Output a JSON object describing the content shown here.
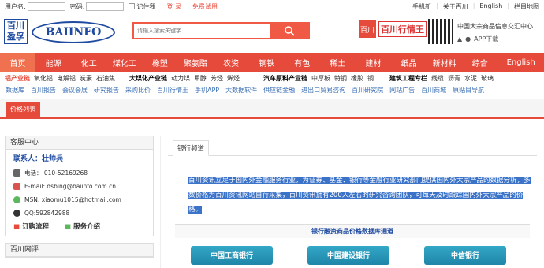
{
  "topbar": {
    "username_label": "用户名:",
    "password_label": "密码:",
    "remember_label": "记住我",
    "login_label": "登 录",
    "trial_label": "免费试用",
    "right_links": [
      "手机新",
      "关于百川",
      "English",
      "栏目地图"
    ]
  },
  "header": {
    "logo_cn": "百川\n盈孚",
    "logo_en": "BAIINFO",
    "search_placeholder": "请输入搜索关键字",
    "brand_name": "百川行情王",
    "brand_square": "百川",
    "qr_title": "中国大宗商品信息交汇中心",
    "app_label": "APP下载"
  },
  "nav": [
    "首页",
    "能源",
    "化工",
    "煤化工",
    "橡塑",
    "聚氨酯",
    "农资",
    "钢铁",
    "有色",
    "稀土",
    "建材",
    "纸品",
    "新材料",
    "综合",
    "English"
  ],
  "categories": {
    "row1": [
      {
        "title": "铝产业链",
        "items": [
          "氧化铝",
          "电解铝",
          "炭素",
          "石油焦"
        ]
      },
      {
        "title": "大煤化产业链",
        "items": [
          "动力煤",
          "甲醇",
          "芳烃",
          "烯烃"
        ]
      },
      {
        "title": "汽车原料产业链",
        "items": [
          "中厚板",
          "特钢",
          "橡胶",
          "铜"
        ]
      },
      {
        "title": "建筑工程专栏",
        "items": [
          "线缆",
          "沥青",
          "水泥",
          "玻璃"
        ]
      }
    ],
    "links": [
      "数据库",
      "百川报告",
      "会议会展",
      "研究报告",
      "采购比价",
      "百川行情王",
      "手机APP",
      "大数据软件",
      "供应链金融",
      "进出口贸易咨询",
      "百川研究院",
      "网站广告",
      "百川商城",
      "原贴目导航"
    ]
  },
  "price_tab": "价格列表",
  "sidebar": {
    "service_title": "客服中心",
    "contact_label": "联系人：",
    "contact_name": "壮帅兵",
    "phone": "电话：  010-52169268",
    "email": "E-mail: dsbing@baiinfo.com.cn",
    "msn": "MSN: xiaomu1015@hotmail.com",
    "qq": "QQ:592842988",
    "order_flow": "订购流程",
    "service_intro": "服务介绍",
    "review_title": "百川网评"
  },
  "main": {
    "tab": "银行频道",
    "intro": "百川资讯立足于国内外金融服务行业，为证券、基金、银行等金融行业研究部门提供国内外大宗产品的数据分析，多数价格为百川资讯网站自行采集，百川资讯拥有200人左右的研究咨询团队，可每天及时跟踪国内外大宗产品的价格。",
    "db_title": "银行融资商品价格数据库通道",
    "banks": [
      "中国工商银行",
      "中国建设银行",
      "中信银行"
    ]
  },
  "colors": {
    "accent": "#e64a3b",
    "brand_blue": "#1e4aa0",
    "bank_button": "#2a98b9",
    "selection": "#3b73c9"
  }
}
